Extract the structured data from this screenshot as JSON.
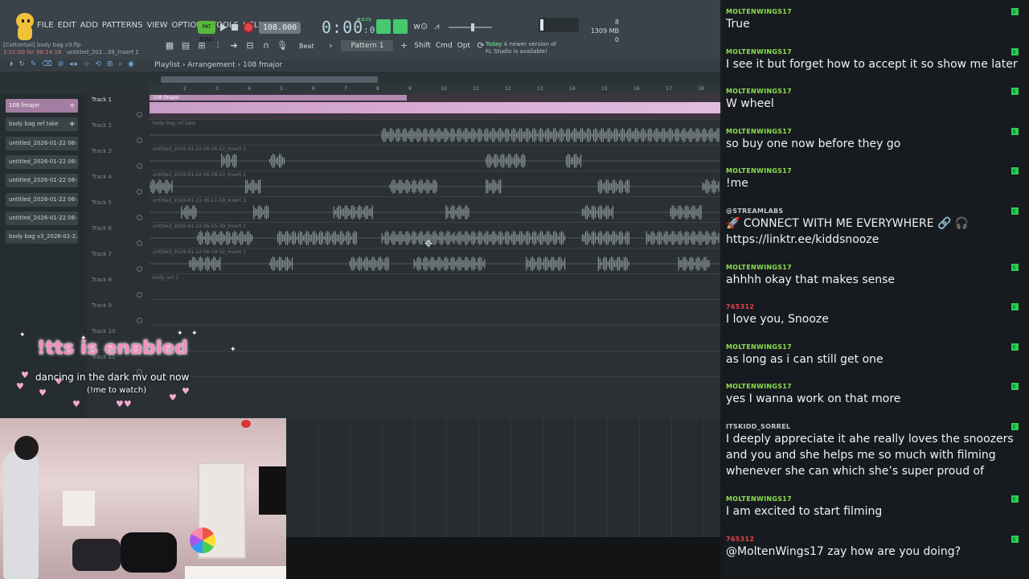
{
  "fl": {
    "menu": [
      "FILE",
      "EDIT",
      "ADD",
      "PATTERNS",
      "VIEW",
      "OPTIONS",
      "TOOLS",
      "HELP"
    ],
    "project_title": "[Cottontail] body bag v3.flp",
    "project_time": "1:01:00 for 98:14:18",
    "project_insert": "untitled_202...39_Insert 1",
    "pat_song": "PAT SONG",
    "tempo": "108.000",
    "time_main": "0:00",
    "time_small": ":00",
    "time_label": "M:S:CS",
    "cpu_top": "8",
    "cpu_mem": "1309 MB",
    "cpu_bottom": "0",
    "snap": "Beat",
    "pattern": "Pattern 1",
    "btn_shift": "Shift",
    "btn_cmd": "Cmd",
    "btn_opt": "Opt",
    "news_date": "Today",
    "news_line1": "A newer version of",
    "news_line2": "FL Studio is available!",
    "breadcrumb": "Playlist › Arrangement › 108 fmajor"
  },
  "ruler": [
    "2",
    "3",
    "4",
    "5",
    "6",
    "7",
    "8",
    "9",
    "10",
    "11",
    "12",
    "13",
    "14",
    "15",
    "16",
    "17",
    "18"
  ],
  "picker": [
    {
      "label": "108 fmajor",
      "selected": true
    },
    {
      "label": "body bag ref take",
      "selected": false
    },
    {
      "label": "untitled_2026-01-22 06-...",
      "selected": false
    },
    {
      "label": "untitled_2026-01-22 06-...",
      "selected": false
    },
    {
      "label": "untitled_2026-01-22 06-...",
      "selected": false
    },
    {
      "label": "untitled_2026-01-22 06-...",
      "selected": false
    },
    {
      "label": "untitled_2026-01-22 06-...",
      "selected": false
    },
    {
      "label": "body bag v3_2026-01-2...",
      "selected": false
    }
  ],
  "tracks": [
    {
      "name": "Track 1",
      "clip": "108 fmajor"
    },
    {
      "name": "Track 2",
      "clip": "body bag ref take"
    },
    {
      "name": "Track 3",
      "clip": "untitled_2026-01-22 06-06-52_Insert 1"
    },
    {
      "name": "Track 4",
      "clip": "untitled_2026-01-22 06-08-20_Insert 1"
    },
    {
      "name": "Track 5",
      "clip": "untitled_2026-01-22 06-11-59_Insert 1"
    },
    {
      "name": "Track 6",
      "clip": "untitled_2026-01-22 06-15-39_Insert 1"
    },
    {
      "name": "Track 7",
      "clip": "untitled_2026-01-22 06-19-52_Insert 1"
    },
    {
      "name": "Track 8",
      "clip": "body_ert 1"
    },
    {
      "name": "Track 9",
      "clip": ""
    },
    {
      "name": "Track 10",
      "clip": ""
    },
    {
      "name": "Track 11",
      "clip": ""
    }
  ],
  "overlay": {
    "title": "!tts is enabled",
    "line": "dancing in the dark mv out now",
    "sub": "(!me to watch)"
  },
  "chat": [
    {
      "user": "MOLTENWINGS17",
      "color": "green",
      "text": "True"
    },
    {
      "user": "MOLTENWINGS17",
      "color": "green",
      "text": "I see it but forget how to accept it so show me later"
    },
    {
      "user": "MOLTENWINGS17",
      "color": "green",
      "text": "W wheel"
    },
    {
      "user": "MOLTENWINGS17",
      "color": "green",
      "text": "so buy one now before they go"
    },
    {
      "user": "MOLTENWINGS17",
      "color": "green",
      "text": "!me"
    },
    {
      "user": "@STREAMLABS",
      "color": "gray",
      "text": "🚀 CONNECT WITH ME EVERYWHERE 🔗 🎧 https://linktr.ee/kiddsnooze"
    },
    {
      "user": "MOLTENWINGS17",
      "color": "green",
      "text": "ahhhh okay that makes sense"
    },
    {
      "user": "765312",
      "color": "red",
      "text": "I love you, Snooze"
    },
    {
      "user": "MOLTENWINGS17",
      "color": "green",
      "text": "as long as i can still get one"
    },
    {
      "user": "MOLTENWINGS17",
      "color": "green",
      "text": "yes I wanna work on that more"
    },
    {
      "user": "ITSKIDD_SORREL",
      "color": "gray",
      "text": "I deeply appreciate it ahe really loves the snoozers and you and she helps me so much with filming whenever she can which she’s super proud of"
    },
    {
      "user": "MOLTENWINGS17",
      "color": "green",
      "text": "I am excited to start filming"
    },
    {
      "user": "765312",
      "color": "red",
      "text": "@MoltenWings17 zay how are you doing?"
    }
  ],
  "colors": {
    "accent_green": "#8be04e",
    "pink": "#f38fbf",
    "clip_purple": "#a47da3"
  }
}
